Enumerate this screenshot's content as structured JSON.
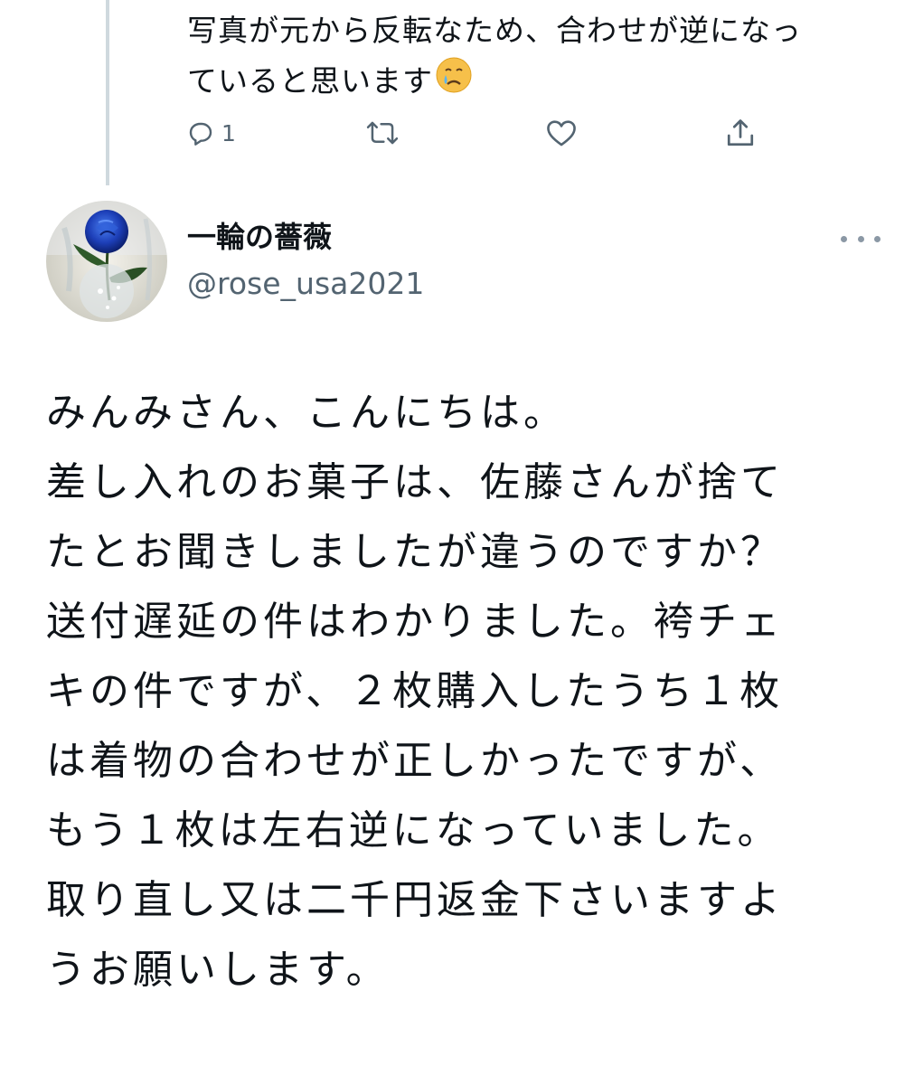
{
  "reply": {
    "text_lines": [
      "写真が元から反転なため、合わせが逆になっ",
      "ていると思います"
    ],
    "emoji": "crying-face",
    "reply_count": "1"
  },
  "tweet": {
    "display_name": "一輪の薔薇",
    "handle": "@rose_usa2021",
    "body_lines": [
      "みんみさん、こんにちは。",
      "差し入れのお菓子は、佐藤さんが捨て",
      "たとお聞きしましたが違うのですか？",
      "送付遅延の件はわかりました。袴チェ",
      "キの件ですが、２枚購入したうち１枚",
      "は着物の合わせが正しかったですが、",
      "もう１枚は左右逆になっていました。",
      "取り直し又は二千円返金下さいますよ",
      "うお願いします。"
    ]
  },
  "colors": {
    "text": "#0f1419",
    "secondary": "#536471",
    "thread_line": "#cfd9de",
    "link": "#1d9bf0"
  },
  "icons": {
    "reply": "reply-icon",
    "retweet": "retweet-icon",
    "like": "heart-icon",
    "share": "share-icon",
    "more": "more-icon"
  }
}
